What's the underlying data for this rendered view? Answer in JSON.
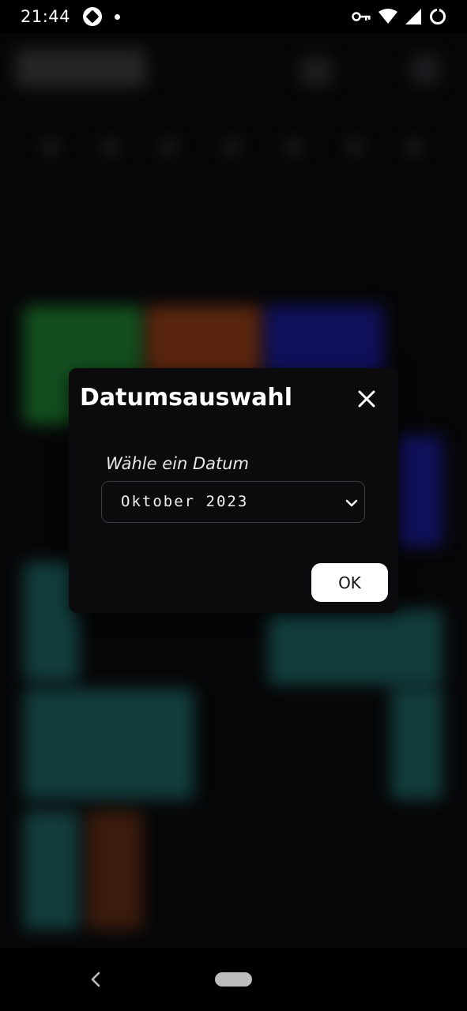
{
  "status_bar": {
    "time": "21:44",
    "icons": [
      "app-notification-icon",
      "dot-icon",
      "vpn-key-icon",
      "wifi-icon",
      "signal-icon",
      "battery-saver-icon"
    ]
  },
  "dialog": {
    "title": "Datumsauswahl",
    "close_icon": "close-icon",
    "label": "Wähle ein Datum",
    "select_value": "Oktober 2023",
    "chevron_icon": "chevron-down-icon",
    "ok_label": "OK"
  },
  "nav_bar": {
    "back_icon": "back-chevron-icon",
    "home_icon": "home-pill-icon"
  },
  "colors": {
    "background": "#0a0a0c",
    "dialog_bg": "#0b0b0d",
    "button_bg": "#ffffff",
    "calendar_green": "#1e7a2e",
    "calendar_orange": "#8a3a18",
    "calendar_blue": "#1a1a8c",
    "calendar_teal": "#1d5e5e"
  }
}
